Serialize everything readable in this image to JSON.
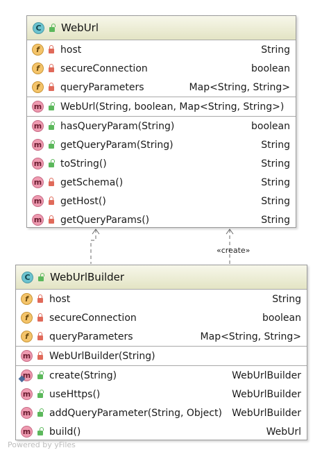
{
  "web_url": {
    "kind_badge": "C",
    "name": "WebUrl",
    "fields": [
      {
        "name": "host",
        "type": "String"
      },
      {
        "name": "secureConnection",
        "type": "boolean"
      },
      {
        "name": "queryParameters",
        "type": "Map<String, String>"
      }
    ],
    "constructors": [
      {
        "name": "WebUrl(String, boolean, Map<String, String>)",
        "type": ""
      }
    ],
    "methods": [
      {
        "name": "hasQueryParam(String)",
        "type": "boolean"
      },
      {
        "name": "getQueryParam(String)",
        "type": "String"
      },
      {
        "name": "toString()",
        "type": "String"
      },
      {
        "name": "getSchema()",
        "type": "String"
      },
      {
        "name": "getHost()",
        "type": "String"
      },
      {
        "name": "getQueryParams()",
        "type": "String"
      }
    ]
  },
  "web_url_builder": {
    "kind_badge": "C",
    "name": "WebUrlBuilder",
    "fields": [
      {
        "name": "host",
        "type": "String"
      },
      {
        "name": "secureConnection",
        "type": "boolean"
      },
      {
        "name": "queryParameters",
        "type": "Map<String, String>"
      }
    ],
    "constructors": [
      {
        "name": "WebUrlBuilder(String)",
        "type": ""
      }
    ],
    "methods": [
      {
        "name": "create(String)",
        "type": "WebUrlBuilder"
      },
      {
        "name": "useHttps()",
        "type": "WebUrlBuilder"
      },
      {
        "name": "addQueryParameter(String, Object)",
        "type": "WebUrlBuilder"
      },
      {
        "name": "build()",
        "type": "WebUrl"
      }
    ]
  },
  "badges": {
    "field": "f",
    "method": "m"
  },
  "relations": {
    "create_label": "«create»"
  },
  "footer": {
    "text": "Powered by yFiles"
  }
}
